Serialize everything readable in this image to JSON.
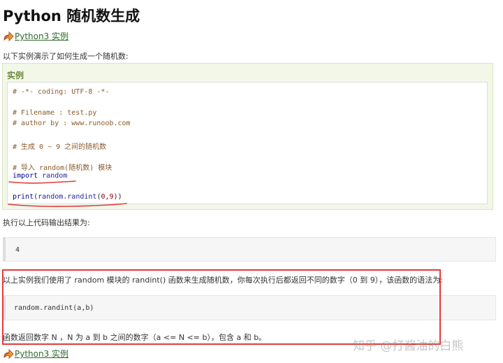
{
  "page": {
    "title": "Python 随机数生成",
    "example_link": "Python3 实例",
    "intro": "以下实例演示了如何生成一个随机数:",
    "example_label": "实例",
    "code": {
      "l1": "# -*- coding: UTF-8 -*-",
      "l2": "# Filename : test.py",
      "l3": "# author by : www.runoob.com",
      "l4": "# 生成 0 ~ 9 之间的随机数",
      "l5": "# 导入 random(随机数) 模块",
      "import_kw": "import",
      "import_mod": "random",
      "print_fn": "print",
      "print_open": "(",
      "print_call": "random.randint",
      "print_args_open": "(",
      "print_arg1": "0",
      "print_sep": ",",
      "print_arg2": "9",
      "print_close": "))"
    },
    "after_text": "执行以上代码输出结果为:",
    "output": "4",
    "description": "以上实例我们使用了 random 模块的 randint() 函数来生成随机数，你每次执行后都返回不同的数字（0 到 9），该函数的语法为:",
    "syntax": "random.randint(a,b)",
    "return_text": "函数返回数字 N ，N 为 a 到 b 之间的数字（a <= N <= b），包含 a 和 b。",
    "bottom_link": "Python3 实例",
    "watermark": "知乎 @打酱油的白熊"
  },
  "colors": {
    "link_green": "#2e6a2e",
    "example_label": "#6c8b3a",
    "annotation_red": "#e03c3c",
    "comment": "#8b5a2b",
    "keyword": "#00008b"
  },
  "icons": [
    "arrow-right-icon"
  ]
}
